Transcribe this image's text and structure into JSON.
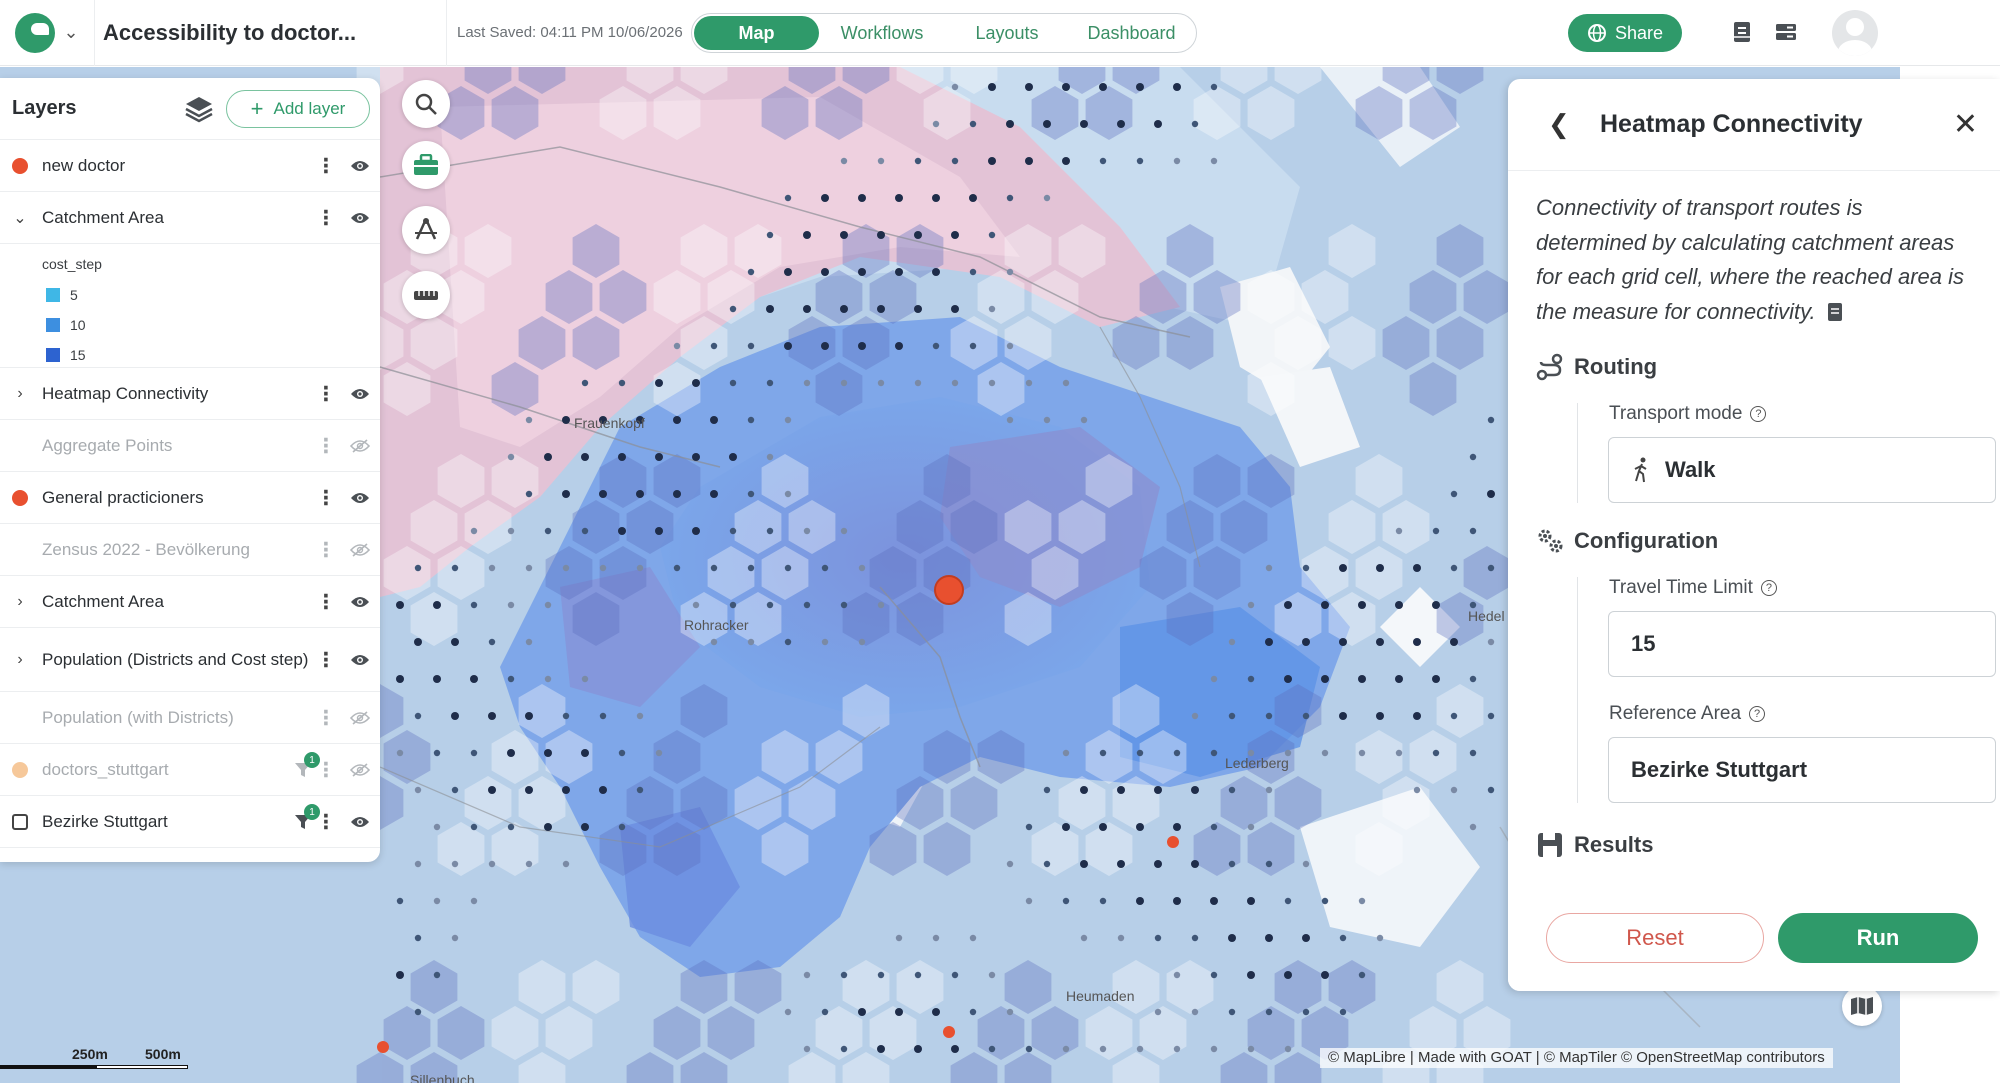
{
  "header": {
    "project_title": "Accessibility to doctor...",
    "last_saved": "Last Saved: 04:11 PM 10/06/2026",
    "tabs": [
      {
        "label": "Map",
        "active": true
      },
      {
        "label": "Workflows",
        "active": false
      },
      {
        "label": "Layouts",
        "active": false
      },
      {
        "label": "Dashboard",
        "active": false
      }
    ],
    "share_label": "Share",
    "accent_color": "#2f9a6a"
  },
  "layers_panel": {
    "title": "Layers",
    "add_layer_label": "Add layer",
    "legend": {
      "title": "cost_step",
      "items": [
        {
          "label": "5",
          "color": "#3fb7e6"
        },
        {
          "label": "10",
          "color": "#3d8fe0"
        },
        {
          "label": "15",
          "color": "#2d63d0"
        }
      ]
    },
    "layers": [
      {
        "name": "new doctor",
        "marker": "dot",
        "color": "#e8502f",
        "visible": true,
        "muted": false
      },
      {
        "name": "Catchment Area",
        "marker": "chevron-down",
        "visible": true,
        "muted": false
      },
      {
        "name": "Heatmap Connectivity",
        "marker": "chevron-right",
        "visible": true,
        "muted": false
      },
      {
        "name": "Aggregate Points",
        "marker": "none",
        "visible": false,
        "muted": true
      },
      {
        "name": "General practicioners",
        "marker": "dot",
        "color": "#e8502f",
        "visible": true,
        "muted": false
      },
      {
        "name": "Zensus 2022 - Bevölkerung",
        "marker": "none",
        "visible": false,
        "muted": true
      },
      {
        "name": "Catchment Area",
        "marker": "chevron-right",
        "visible": true,
        "muted": false
      },
      {
        "name": "Population (Districts and Cost step)",
        "marker": "chevron-right",
        "visible": true,
        "muted": false
      },
      {
        "name": "Population (with Districts)",
        "marker": "none",
        "visible": false,
        "muted": true
      },
      {
        "name": "doctors_stuttgart",
        "marker": "dot",
        "color": "#f6c89a",
        "visible": false,
        "muted": true,
        "filter_count": "1"
      },
      {
        "name": "Bezirke Stuttgart",
        "marker": "checkbox",
        "visible": true,
        "muted": false,
        "filter_count": "1"
      }
    ]
  },
  "tools": [
    "search-icon",
    "toolbox-icon",
    "draw-icon",
    "ruler-icon"
  ],
  "tool_panel": {
    "title": "Heatmap Connectivity",
    "description": "Connectivity of transport routes is determined by calculating catchment areas for each grid cell, where the reached area is the measure for connectivity.",
    "routing": {
      "title": "Routing",
      "transport_mode_label": "Transport mode",
      "transport_mode_value": "Walk"
    },
    "configuration": {
      "title": "Configuration",
      "travel_time_label": "Travel Time Limit",
      "travel_time_value": "15",
      "reference_area_label": "Reference Area",
      "reference_area_value": "Bezirke Stuttgart"
    },
    "results_title": "Results",
    "reset_label": "Reset",
    "run_label": "Run"
  },
  "map": {
    "place_labels": [
      "Frauenkopf",
      "Rohracker",
      "Hedel",
      "Lederberg",
      "Heumaden",
      "Sillenbuch"
    ],
    "scale_labels": [
      "250m",
      "500m"
    ],
    "attribution": "© MapLibre | Made with GOAT | © MapTiler © OpenStreetMap contributors"
  }
}
